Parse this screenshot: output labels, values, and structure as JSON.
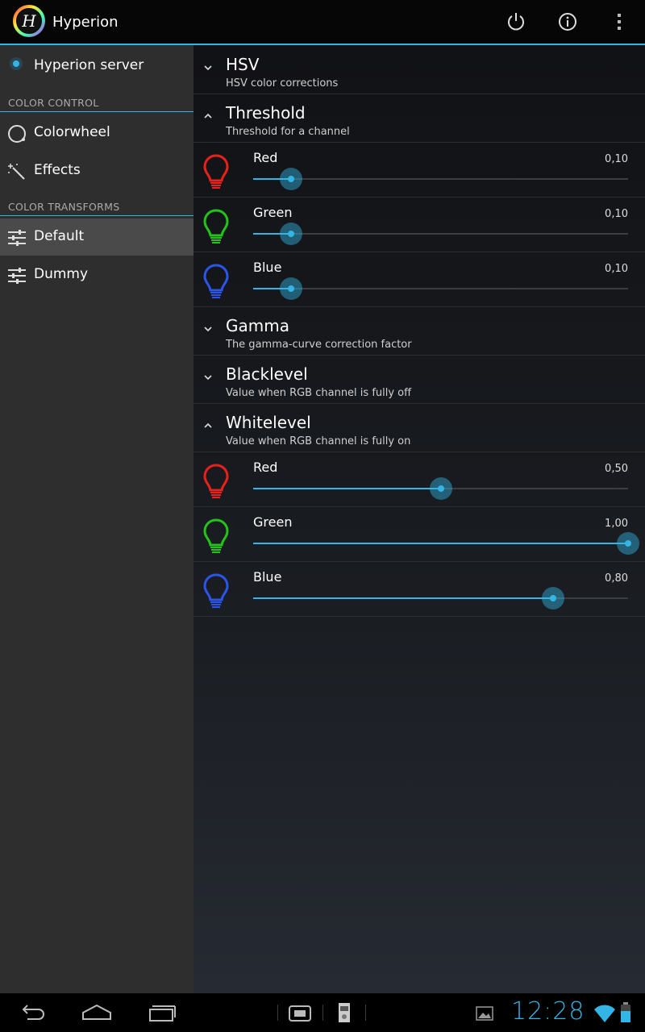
{
  "app": {
    "title": "Hyperion"
  },
  "sidebar": {
    "server": {
      "label": "Hyperion server"
    },
    "color_control_header": "COLOR CONTROL",
    "color_control_items": [
      {
        "label": "Colorwheel",
        "icon": "colorwheel-icon"
      },
      {
        "label": "Effects",
        "icon": "magic-wand-icon"
      }
    ],
    "color_transforms_header": "COLOR TRANSFORMS",
    "transform_items": [
      {
        "label": "Default",
        "icon": "sliders-icon",
        "active": true
      },
      {
        "label": "Dummy",
        "icon": "sliders-icon",
        "active": false
      }
    ]
  },
  "groups": {
    "hsv": {
      "title": "HSV",
      "subtitle": "HSV color corrections",
      "expanded": false
    },
    "threshold": {
      "title": "Threshold",
      "subtitle": "Threshold for a channel",
      "expanded": true,
      "sliders": [
        {
          "label": "Red",
          "value_text": "0,10",
          "value": 0.1,
          "color": "#e8211b"
        },
        {
          "label": "Green",
          "value_text": "0,10",
          "value": 0.1,
          "color": "#22c41a"
        },
        {
          "label": "Blue",
          "value_text": "0,10",
          "value": 0.1,
          "color": "#2a55e8"
        }
      ]
    },
    "gamma": {
      "title": "Gamma",
      "subtitle": "The gamma-curve correction factor",
      "expanded": false
    },
    "blacklevel": {
      "title": "Blacklevel",
      "subtitle": "Value when RGB channel is fully off",
      "expanded": false
    },
    "whitelevel": {
      "title": "Whitelevel",
      "subtitle": "Value when RGB channel is fully on",
      "expanded": true,
      "sliders": [
        {
          "label": "Red",
          "value_text": "0,50",
          "value": 0.5,
          "color": "#e8211b"
        },
        {
          "label": "Green",
          "value_text": "1,00",
          "value": 1.0,
          "color": "#22c41a"
        },
        {
          "label": "Blue",
          "value_text": "0,80",
          "value": 0.8,
          "color": "#2a55e8"
        }
      ]
    }
  },
  "status": {
    "time": "12:28"
  },
  "colors": {
    "accent": "#33b5e5"
  }
}
